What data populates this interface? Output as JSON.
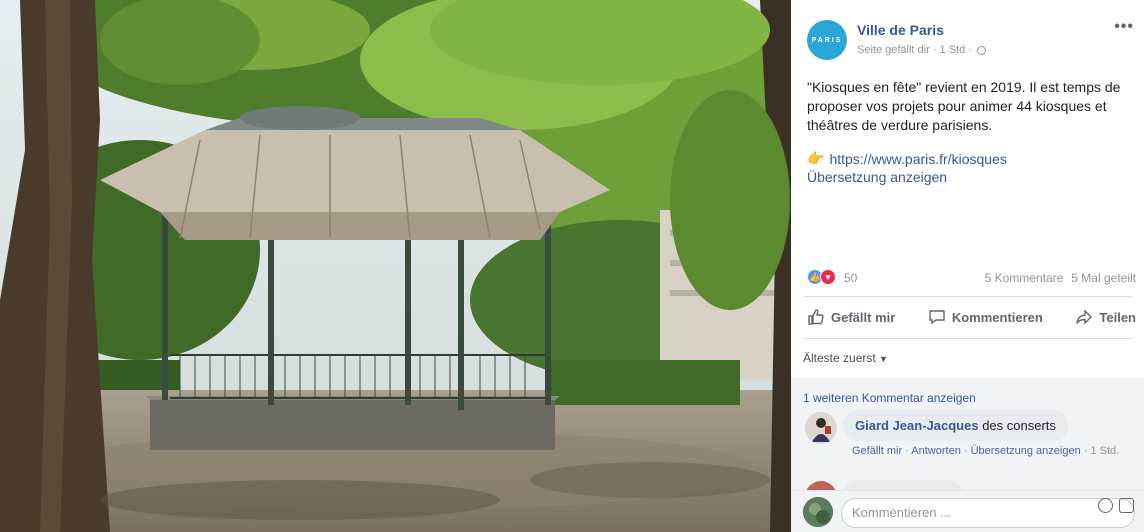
{
  "post": {
    "page_name": "Ville de Paris",
    "avatar_text": "PARIS",
    "meta_text": "Seite gefällt dir · 1 Std ·",
    "more_label": "•••",
    "text": "\"Kiosques en fête\" revient en 2019. Il est temps de proposer vos projets pour animer 44 kiosques et théâtres de verdure parisiens.",
    "link_emoji": "👉",
    "link": "https://www.paris.fr/kiosques",
    "translate": "Übersetzung anzeigen"
  },
  "stats": {
    "reaction_count": "50",
    "comments": "5 Kommentare",
    "shares": "5 Mal geteilt"
  },
  "actions": {
    "like": "Gefällt mir",
    "comment": "Kommentieren",
    "share": "Teilen"
  },
  "comments": {
    "sort_label": "Älteste zuerst",
    "more_label": "1 weiteren Kommentar anzeigen",
    "items": [
      {
        "author": "Giard Jean-Jacques",
        "text": "des conserts",
        "like": "Gefällt mir",
        "reply": "Antworten",
        "translate": "Übersetzung anzeigen",
        "time": "1 Std."
      }
    ],
    "input_placeholder": "Kommentieren ..."
  },
  "icons": {
    "like": "thumbs-up-icon",
    "comment": "speech-bubble-icon",
    "share": "share-arrow-icon",
    "emoji": "smiley-icon",
    "sticker": "sticker-icon",
    "privacy": "globe-icon"
  },
  "colors": {
    "link": "#365899",
    "avatar": "#2aa7d8",
    "like_reaction": "#5890ff",
    "love_reaction": "#f0284a"
  }
}
